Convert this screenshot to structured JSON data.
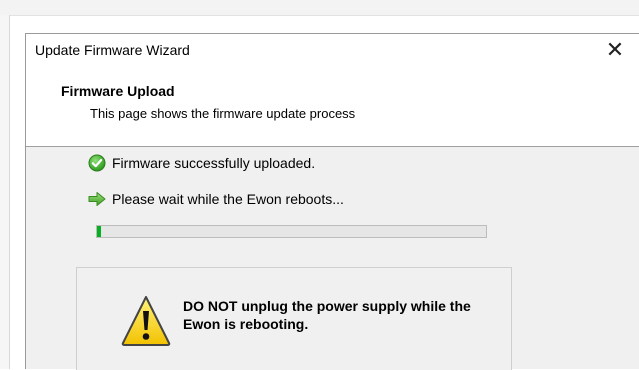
{
  "window": {
    "title": "Update Firmware Wizard",
    "close_symbol": "✕"
  },
  "header": {
    "title": "Firmware Upload",
    "subtitle": "This page shows the firmware update process"
  },
  "status": [
    {
      "icon": "check-circle-icon",
      "text": "Firmware successfully uploaded."
    },
    {
      "icon": "arrow-right-icon",
      "text": "Please wait while the Ewon reboots..."
    }
  ],
  "progress": {
    "fraction": 0.01,
    "color": "#06b025"
  },
  "warning": {
    "icon": "warning-icon",
    "text": "DO NOT unplug the power supply while the Ewon is rebooting."
  },
  "colors": {
    "dialog_bg": "#f0f0f0",
    "accent_green": "#06b025",
    "warning_yellow": "#ffe11a"
  }
}
